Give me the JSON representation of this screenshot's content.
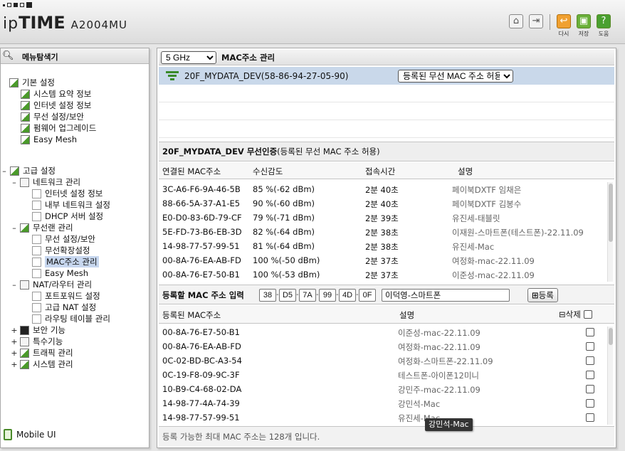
{
  "header": {
    "brand_prefix": "ip",
    "brand_main": "TIME",
    "model": "A2004MU",
    "icons": [
      {
        "name": "home-icon",
        "label": ""
      },
      {
        "name": "logout-icon",
        "label": ""
      },
      {
        "name": "undo-icon",
        "label": "다시"
      },
      {
        "name": "save-icon",
        "label": "저장"
      },
      {
        "name": "help-icon",
        "label": "도움"
      }
    ]
  },
  "left_nav": {
    "title": "메뉴탐색기",
    "basic_settings": "기본 설정",
    "basic_items": [
      "시스템 요약 정보",
      "인터넷 설정 정보",
      "무선 설정/보안",
      "펌웨어 업그레이드",
      "Easy Mesh"
    ],
    "advanced_settings": "고급 설정",
    "network_mgmt": "네트워크 관리",
    "network_items": [
      "인터넷 설정 정보",
      "내부 네트워크 설정",
      "DHCP 서버 설정"
    ],
    "wireless_mgmt": "무선랜 관리",
    "wireless_items": [
      "무선 설정/보안",
      "무선확장설정",
      "MAC주소 관리",
      "Easy Mesh"
    ],
    "nat_mgmt": "NAT/라우터 관리",
    "nat_items": [
      "포트포워드 설정",
      "고급 NAT 설정",
      "라우팅 테이블 관리"
    ],
    "others": [
      "보안 기능",
      "특수기능",
      "트래픽 관리",
      "시스템 관리"
    ],
    "mobile_ui": "Mobile UI"
  },
  "main": {
    "band_select": "5 GHz",
    "page_title": "MAC주소 관리",
    "ssid": "20F_MYDATA_DEV(58-86-94-27-05-90)",
    "policy_select": "등록된 무선 MAC 주소 허용",
    "auth_title_bold": "20F_MYDATA_DEV 무선인증",
    "auth_title_rest": " (등록된 무선 MAC 주소 허용)",
    "connected_headers": {
      "mac": "연결된 MAC주소",
      "signal": "수신감도",
      "time": "접속시간",
      "desc": "설명"
    },
    "connected": [
      {
        "mac": "3C-A6-F6-9A-46-5B",
        "signal": "85 %(-62 dBm)",
        "time": "2분 40초",
        "desc": "페이북DXTF 임채은"
      },
      {
        "mac": "88-66-5A-37-A1-E5",
        "signal": "90 %(-60 dBm)",
        "time": "2분 40초",
        "desc": "페이북DXTF 김봉수"
      },
      {
        "mac": "E0-D0-83-6D-79-CF",
        "signal": "79 %(-71 dBm)",
        "time": "2분 39초",
        "desc": "유진세-태블릿"
      },
      {
        "mac": "5E-FD-73-B6-EB-3D",
        "signal": "82 %(-64 dBm)",
        "time": "2분 38초",
        "desc": "이재원-스마트폰(테스트폰)-22.11.09"
      },
      {
        "mac": "14-98-77-57-99-51",
        "signal": "81 %(-64 dBm)",
        "time": "2분 38초",
        "desc": "유진세-Mac"
      },
      {
        "mac": "00-8A-76-EA-AB-FD",
        "signal": "100 %(-50 dBm)",
        "time": "2분 37초",
        "desc": "여정화-mac-22.11.09"
      },
      {
        "mac": "00-8A-76-E7-50-B1",
        "signal": "100 %(-53 dBm)",
        "time": "2분 37초",
        "desc": "이준성-mac-22.11.09"
      }
    ],
    "input_label": "등록할 MAC 주소 입력",
    "mac_octets": [
      "38",
      "D5",
      "7A",
      "99",
      "4D",
      "0F"
    ],
    "desc_value": "이덕영-스마트폰",
    "register_button": "등록",
    "registered_headers": {
      "mac": "등록된 MAC주소",
      "desc": "설명",
      "delete": "삭제"
    },
    "registered": [
      {
        "mac": "00-8A-76-E7-50-B1",
        "desc": "이준성-mac-22.11.09"
      },
      {
        "mac": "00-8A-76-EA-AB-FD",
        "desc": "여정화-mac-22.11.09"
      },
      {
        "mac": "0C-02-BD-BC-A3-54",
        "desc": "여정화-스마트폰-22.11.09"
      },
      {
        "mac": "0C-19-F8-09-9C-3F",
        "desc": "테스트폰-아이폰12미니"
      },
      {
        "mac": "10-B9-C4-68-02-DA",
        "desc": "강민주-mac-22.11.09"
      },
      {
        "mac": "14-98-77-4A-74-39",
        "desc": "강민석-Mac"
      },
      {
        "mac": "14-98-77-57-99-51",
        "desc": "유진세-Mac"
      }
    ],
    "footer": "등록 가능한 최대 MAC 주소는 128개 입니다.",
    "tooltip": "강민석-Mac"
  }
}
